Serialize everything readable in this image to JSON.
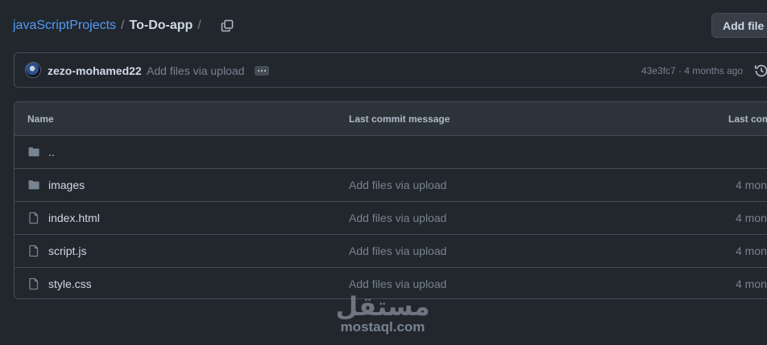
{
  "breadcrumb": {
    "repo": "javaScriptProjects",
    "sep1": "/",
    "folder": "To-Do-app",
    "sep2": "/"
  },
  "actions": {
    "add_file": "Add file"
  },
  "commit": {
    "author": "zezo-mohamed22",
    "message": "Add files via upload",
    "hash": "43e3fc7",
    "meta_sep": "·",
    "time": "4 months ago"
  },
  "table": {
    "headers": {
      "name": "Name",
      "message": "Last commit message",
      "date": "Last com"
    },
    "rows": [
      {
        "type": "folder",
        "name": "..",
        "message": "",
        "date": ""
      },
      {
        "type": "folder",
        "name": "images",
        "message": "Add files via upload",
        "date": "4 mon"
      },
      {
        "type": "file",
        "name": "index.html",
        "message": "Add files via upload",
        "date": "4 mon"
      },
      {
        "type": "file",
        "name": "script.js",
        "message": "Add files via upload",
        "date": "4 mon"
      },
      {
        "type": "file",
        "name": "style.css",
        "message": "Add files via upload",
        "date": "4 mon"
      }
    ]
  },
  "watermark": {
    "arabic": "مستقل",
    "latin": "mostaql.com"
  },
  "colors": {
    "background": "#22272e",
    "link": "#539bf5",
    "border": "#444c56",
    "muted": "#768390"
  }
}
